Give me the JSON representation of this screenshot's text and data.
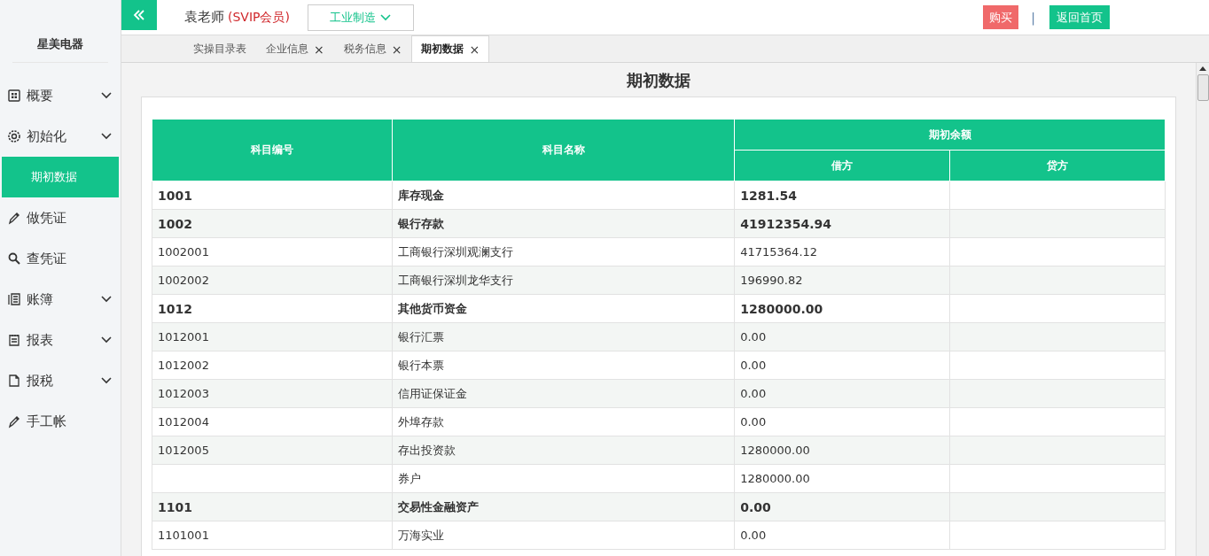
{
  "sidebar": {
    "company": "星美电器",
    "items": [
      {
        "label": "概要",
        "kind": "group",
        "selected": false
      },
      {
        "label": "初始化",
        "kind": "group",
        "selected": false,
        "children": [
          {
            "label": "期初数据",
            "selected": true
          }
        ]
      },
      {
        "label": "做凭证",
        "kind": "link",
        "selected": false
      },
      {
        "label": "查凭证",
        "kind": "link",
        "selected": false
      },
      {
        "label": "账簿",
        "kind": "group",
        "selected": false
      },
      {
        "label": "报表",
        "kind": "group",
        "selected": false
      },
      {
        "label": "报税",
        "kind": "group",
        "selected": false
      },
      {
        "label": "手工帐",
        "kind": "link",
        "selected": false
      }
    ]
  },
  "header": {
    "user": "袁老师",
    "membership": "(SVIP会员)",
    "industry": "工业制造",
    "buy_button": "购买",
    "separator": "|",
    "home_button": "返回首页"
  },
  "tabs": [
    {
      "label": "实操目录表",
      "closable": false,
      "selected": false
    },
    {
      "label": "企业信息",
      "closable": true,
      "selected": false
    },
    {
      "label": "税务信息",
      "closable": true,
      "selected": false
    },
    {
      "label": "期初数据",
      "closable": true,
      "selected": true
    }
  ],
  "close_glyph": "×",
  "page_title": "期初数据",
  "table": {
    "columns": [
      "科目编号",
      "科目名称"
    ],
    "group_header": "期初余额",
    "sub_columns": [
      "借方",
      "贷方"
    ],
    "rows": [
      {
        "code": "1001",
        "name": "库存现金",
        "debit": "1281.54",
        "kind": "parent"
      },
      {
        "code": "1002",
        "name": "银行存款",
        "debit": "41912354.94",
        "kind": "parent"
      },
      {
        "code": "1002001",
        "name": "工商银行深圳观澜支行",
        "debit": "41715364.12",
        "kind": "child"
      },
      {
        "code": "1002002",
        "name": "工商银行深圳龙华支行",
        "debit": "196990.82",
        "kind": "child"
      },
      {
        "code": "1012",
        "name": "其他货币资金",
        "debit": "1280000.00",
        "kind": "parent"
      },
      {
        "code": "1012001",
        "name": "银行汇票",
        "debit": "0.00",
        "kind": "child"
      },
      {
        "code": "1012002",
        "name": "银行本票",
        "debit": "0.00",
        "kind": "child"
      },
      {
        "code": "1012003",
        "name": "信用证保证金",
        "debit": "0.00",
        "kind": "child"
      },
      {
        "code": "1012004",
        "name": "外埠存款",
        "debit": "0.00",
        "kind": "child"
      },
      {
        "code": "1012005",
        "name": "存出投资款",
        "debit": "1280000.00",
        "kind": "child"
      },
      {
        "name": "券户",
        "debit": "1280000.00",
        "kind": "child"
      },
      {
        "code": "1101",
        "name": "交易性金融资产",
        "debit": "0.00",
        "kind": "parent"
      },
      {
        "code": "1101001",
        "name": "万海实业",
        "debit": "0.00",
        "kind": "child"
      }
    ]
  }
}
